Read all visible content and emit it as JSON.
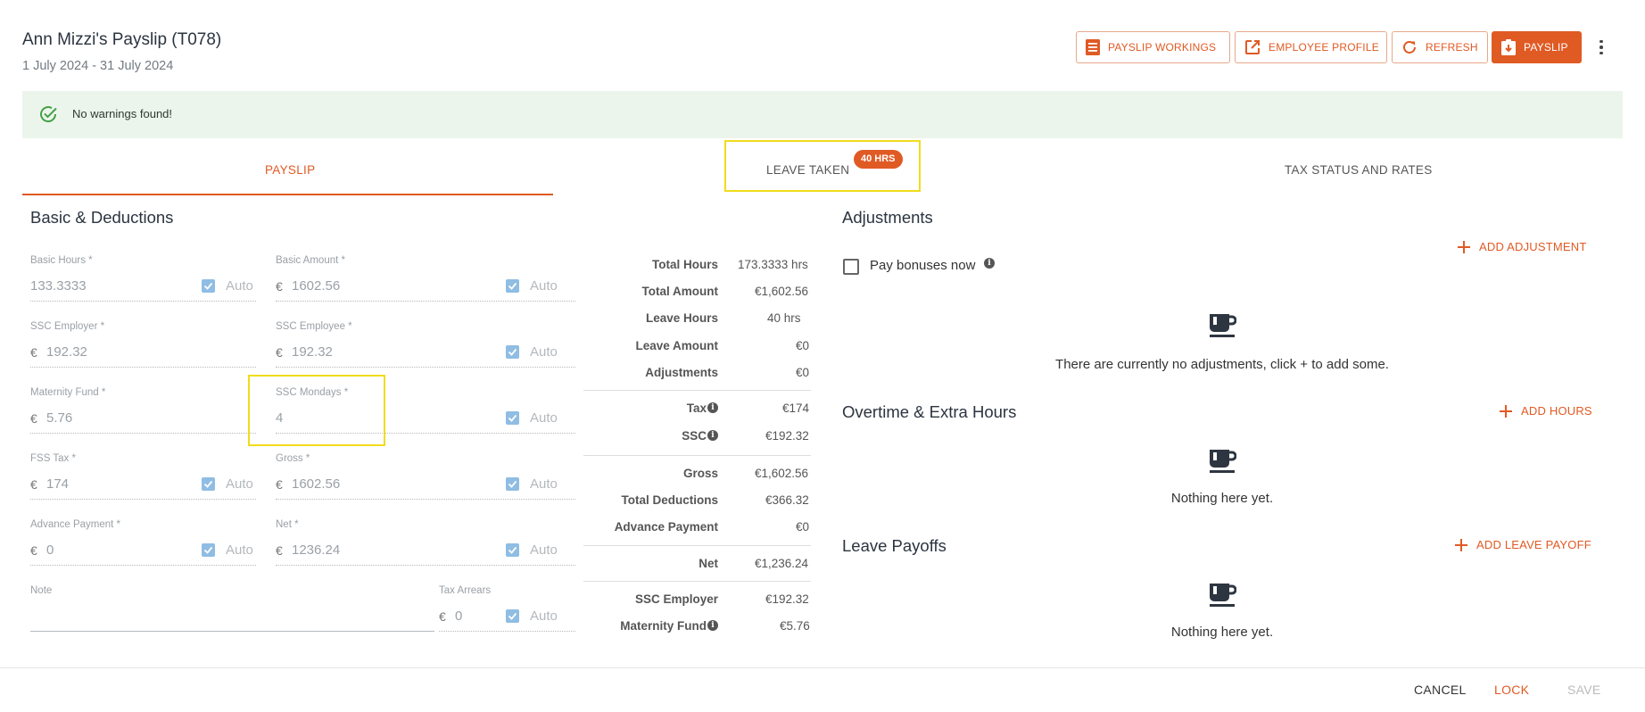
{
  "header": {
    "title": "Ann Mizzi's Payslip (T078)",
    "period": "1 July 2024 - 31 July 2024",
    "buttons": {
      "payslip_workings": "PAYSLIP WORKINGS",
      "employee_profile": "EMPLOYEE PROFILE",
      "refresh": "REFRESH",
      "payslip": "PAYSLIP"
    }
  },
  "banner": {
    "text": "No warnings found!"
  },
  "tabs": {
    "payslip": "PAYSLIP",
    "leave_taken": "LEAVE TAKEN",
    "leave_badge": "40 HRS",
    "tax_status": "TAX STATUS AND RATES"
  },
  "basic": {
    "heading": "Basic & Deductions",
    "auto_label": "Auto",
    "currency": "€",
    "fields": {
      "basic_hours": {
        "label": "Basic Hours *",
        "value": "133.3333"
      },
      "basic_amount": {
        "label": "Basic Amount *",
        "value": "1602.56"
      },
      "ssc_employer": {
        "label": "SSC Employer *",
        "value": "192.32"
      },
      "ssc_employee": {
        "label": "SSC Employee *",
        "value": "192.32"
      },
      "maternity_fund": {
        "label": "Maternity Fund *",
        "value": "5.76"
      },
      "ssc_mondays": {
        "label": "SSC Mondays *",
        "value": "4"
      },
      "fss_tax": {
        "label": "FSS Tax *",
        "value": "174"
      },
      "gross": {
        "label": "Gross *",
        "value": "1602.56"
      },
      "advance_payment": {
        "label": "Advance Payment *",
        "value": "0"
      },
      "net": {
        "label": "Net *",
        "value": "1236.24"
      },
      "note": {
        "label": "Note",
        "value": ""
      },
      "tax_arrears": {
        "label": "Tax Arrears",
        "value": "0"
      }
    }
  },
  "summary": {
    "total_hours": {
      "label": "Total Hours",
      "value": "173.3333 hrs"
    },
    "total_amount": {
      "label": "Total Amount",
      "value": "€1,602.56"
    },
    "leave_hours": {
      "label": "Leave Hours",
      "value": "40 hrs"
    },
    "leave_amount": {
      "label": "Leave Amount",
      "value": "€0"
    },
    "adjustments": {
      "label": "Adjustments",
      "value": "€0"
    },
    "tax": {
      "label": "Tax",
      "value": "€174"
    },
    "ssc": {
      "label": "SSC",
      "value": "€192.32"
    },
    "gross": {
      "label": "Gross",
      "value": "€1,602.56"
    },
    "total_deductions": {
      "label": "Total Deductions",
      "value": "€366.32"
    },
    "advance_payment": {
      "label": "Advance Payment",
      "value": "€0"
    },
    "net": {
      "label": "Net",
      "value": "€1,236.24"
    },
    "ssc_employer": {
      "label": "SSC Employer",
      "value": "€192.32"
    },
    "maternity_fund": {
      "label": "Maternity Fund",
      "value": "€5.76"
    }
  },
  "adjustments": {
    "heading": "Adjustments",
    "add_label": "ADD ADJUSTMENT",
    "pay_bonuses_label": "Pay bonuses now",
    "empty_text": "There are currently no adjustments, click + to add some."
  },
  "overtime": {
    "heading": "Overtime & Extra Hours",
    "add_label": "ADD HOURS",
    "empty_text": "Nothing here yet."
  },
  "leave_payoffs": {
    "heading": "Leave Payoffs",
    "add_label": "ADD LEAVE PAYOFF",
    "empty_text": "Nothing here yet."
  },
  "footer": {
    "cancel": "CANCEL",
    "lock": "LOCK",
    "save": "SAVE"
  }
}
